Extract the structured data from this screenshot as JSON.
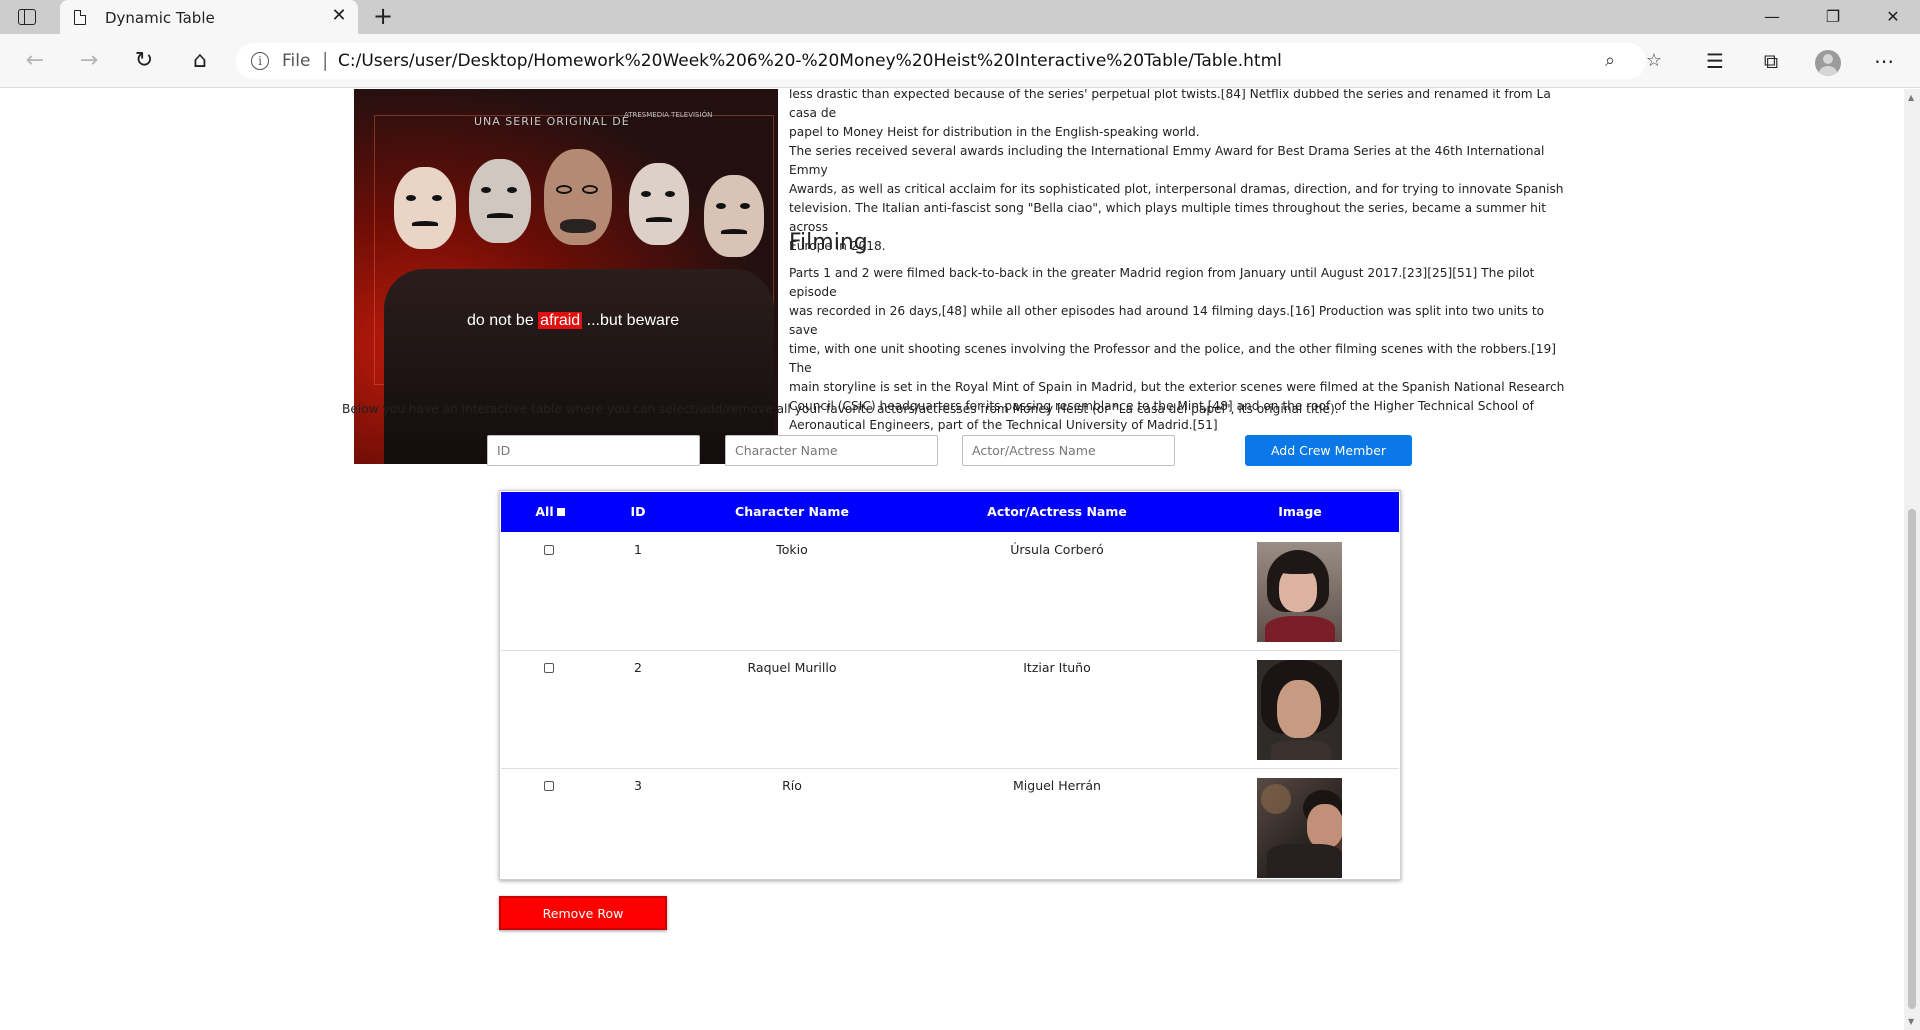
{
  "browser": {
    "tab_title": "Dynamic Table",
    "file_label": "File",
    "url": "C:/Users/user/Desktop/Homework%20Week%206%20-%20Money%20Heist%20Interactive%20Table/Table.html"
  },
  "poster": {
    "subtitle": "UNA SERIE ORIGINAL DE",
    "brand": "ATRESMEDIA TELEVISIÓN",
    "tagline_pre": "do not be ",
    "tagline_highlight": "afraid",
    "tagline_post": " ...but beware"
  },
  "article": {
    "para_top_line1": "less drastic than expected because of the series' perpetual plot twists.[84] Netflix dubbed the series and renamed it from La casa de",
    "para_top_line2": "papel to Money Heist for distribution in the English-speaking world.",
    "para_awards_line1": "The series received several awards including the International Emmy Award for Best Drama Series at the 46th International Emmy",
    "para_awards_line2": "Awards, as well as critical acclaim for its sophisticated plot, interpersonal dramas, direction, and for trying to innovate Spanish",
    "para_awards_line3": "television. The Italian anti-fascist song \"Bella ciao\", which plays multiple times throughout the series, became a summer hit across",
    "para_awards_line4": "Europe in 2018.",
    "filming_heading": "Filming",
    "filming_line1": "Parts 1 and 2 were filmed back-to-back in the greater Madrid region from January until August 2017.[23][25][51] The pilot episode",
    "filming_line2": "was recorded in 26 days,[48] while all other episodes had around 14 filming days.[16] Production was split into two units to save",
    "filming_line3": "time, with one unit shooting scenes involving the Professor and the police, and the other filming scenes with the robbers.[19] The",
    "filming_line4": "main storyline is set in the Royal Mint of Spain in Madrid, but the exterior scenes were filmed at the Spanish National Research",
    "filming_line5": "Council (CSIC) headquarters for its passing resemblance to the Mint,[48] and on the roof of the Higher Technical School of",
    "filming_line6": "Aeronautical Engineers, part of the Technical University of Madrid.[51]"
  },
  "intro_text": "Below you have an interactive table where you can select/add/remove all your favorite actors/actresses from Money Heist (or \"La casa del papel\", its original title).",
  "form": {
    "id_placeholder": "ID",
    "character_placeholder": "Character Name",
    "actor_placeholder": "Actor/Actress Name",
    "add_button": "Add Crew Member"
  },
  "table": {
    "headers": {
      "all": "All",
      "id": "ID",
      "character": "Character Name",
      "actor": "Actor/Actress Name",
      "image": "Image"
    },
    "rows": [
      {
        "id": "1",
        "character": "Tokio",
        "actor": "Úrsula Corberó"
      },
      {
        "id": "2",
        "character": "Raquel Murillo",
        "actor": "Itziar Ituño"
      },
      {
        "id": "3",
        "character": "Río",
        "actor": "Miguel Herrán"
      }
    ]
  },
  "remove_button": "Remove Row",
  "colors": {
    "header_blue": "#0000ff",
    "add_button_blue": "#0a78e6",
    "remove_red": "#ff0000"
  }
}
